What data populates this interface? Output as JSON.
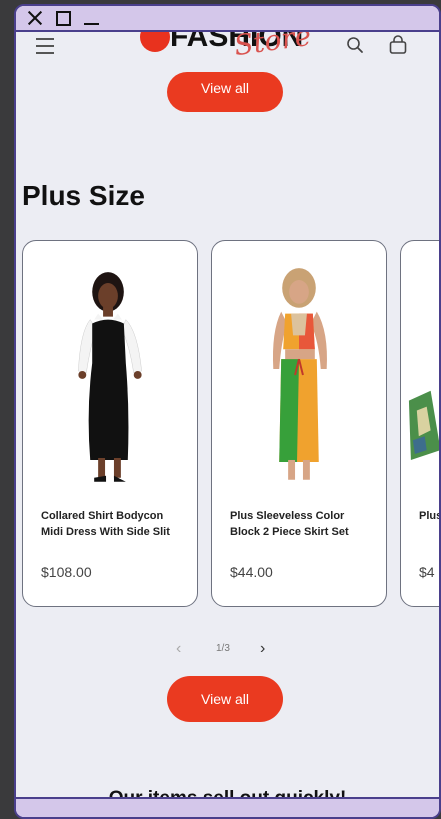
{
  "window": {
    "controls": [
      "close",
      "maximize",
      "minimize"
    ]
  },
  "header": {
    "logo_main": "FASHION",
    "logo_script": "Store",
    "icons": [
      "menu-icon",
      "search-icon",
      "cart-icon"
    ]
  },
  "top_button": {
    "label": "View all"
  },
  "section": {
    "title": "Plus Size"
  },
  "products": [
    {
      "title": "Collared Shirt Bodycon Midi Dress With Side Slit",
      "price": "$108.00"
    },
    {
      "title": "Plus Sleeveless Color Block 2 Piece Skirt Set",
      "price": "$44.00"
    },
    {
      "title": "Plus Print Dress",
      "price": "$4"
    }
  ],
  "pager": {
    "text": "1/3",
    "prev": "‹",
    "next": "›"
  },
  "bottom_button": {
    "label": "View all"
  },
  "tagline": "Our items sell out quickly!",
  "colors": {
    "accent": "#ea3a20",
    "window_border": "#4a3f8c",
    "titlebar": "#d4c7ea",
    "page_bg": "#ecedf3"
  }
}
